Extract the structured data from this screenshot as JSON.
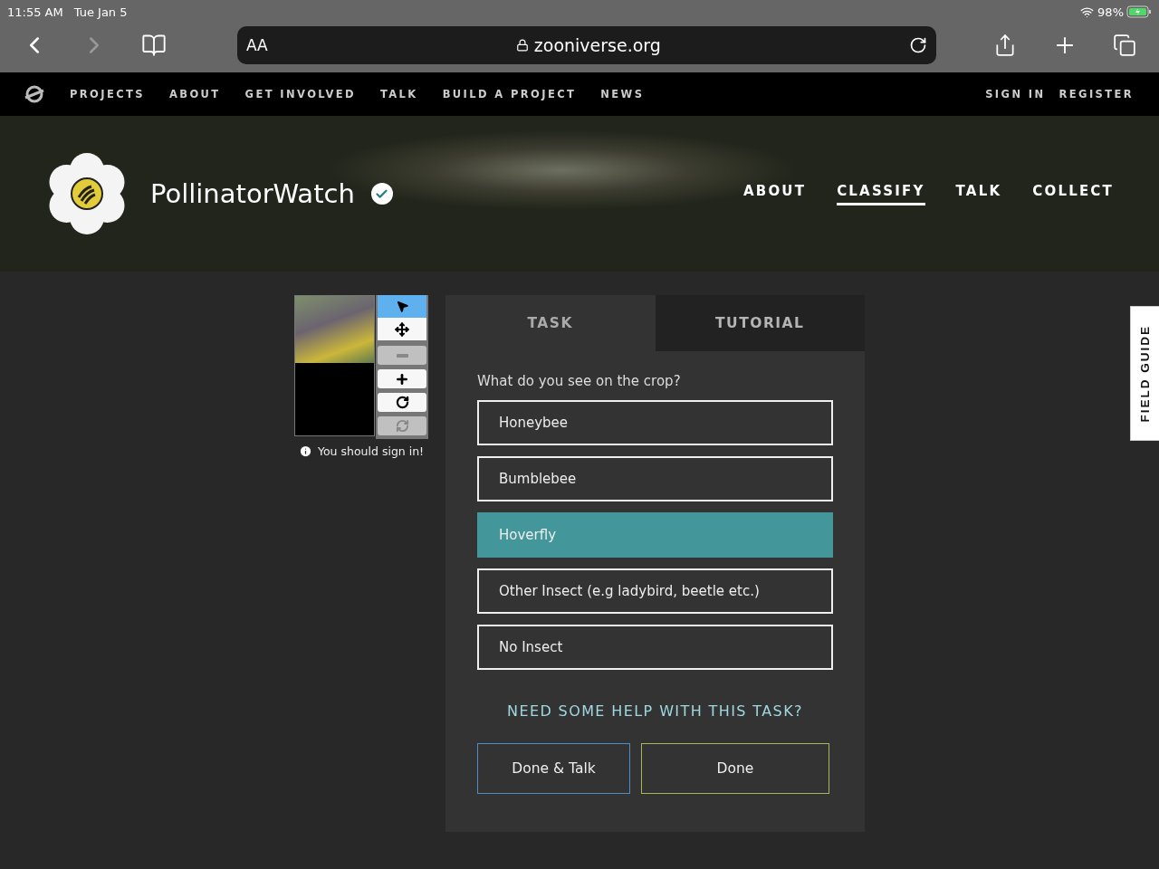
{
  "status_bar": {
    "time": "11:55 AM",
    "date": "Tue Jan 5",
    "battery": "98%"
  },
  "browser": {
    "text_size": "AA",
    "url": "zooniverse.org",
    "forward_disabled": true
  },
  "site_nav": {
    "links": [
      "PROJECTS",
      "ABOUT",
      "GET INVOLVED",
      "TALK",
      "BUILD A PROJECT",
      "NEWS"
    ],
    "account": [
      "SIGN IN",
      "REGISTER"
    ]
  },
  "project": {
    "name": "PollinatorWatch",
    "verified": true,
    "tabs": [
      {
        "label": "ABOUT",
        "selected": false
      },
      {
        "label": "CLASSIFY",
        "selected": true
      },
      {
        "label": "TALK",
        "selected": false
      },
      {
        "label": "COLLECT",
        "selected": false
      }
    ]
  },
  "viewer": {
    "tools": [
      {
        "kind": "pointer",
        "selected": true,
        "disabled": false
      },
      {
        "kind": "move",
        "selected": false,
        "disabled": false
      },
      {
        "kind": "zoom_out",
        "selected": false,
        "disabled": true
      },
      {
        "kind": "zoom_in",
        "selected": false,
        "disabled": false
      },
      {
        "kind": "rotate",
        "selected": false,
        "disabled": false
      },
      {
        "kind": "reset",
        "selected": false,
        "disabled": true
      }
    ],
    "note": "You should sign in!"
  },
  "task": {
    "tabs": [
      {
        "label": "TASK",
        "selected": true
      },
      {
        "label": "TUTORIAL",
        "selected": false
      }
    ],
    "question": "What do you see on the crop?",
    "answers": [
      {
        "label": "Honeybee",
        "selected": false
      },
      {
        "label": "Bumblebee",
        "selected": false
      },
      {
        "label": "Hoverfly",
        "selected": true
      },
      {
        "label": "Other Insect (e.g ladybird, beetle etc.)",
        "selected": false
      },
      {
        "label": "No Insect",
        "selected": false
      }
    ],
    "help": "NEED SOME HELP WITH THIS TASK?",
    "buttons": [
      {
        "label": "Done & Talk",
        "kind": "talk"
      },
      {
        "label": "Done",
        "kind": "done"
      }
    ]
  },
  "field_guide": {
    "label": "FIELD GUIDE"
  }
}
